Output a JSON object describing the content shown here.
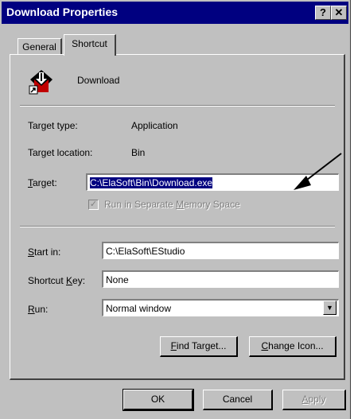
{
  "window": {
    "title": "Download Properties",
    "help_glyph": "?",
    "close_glyph": "✕"
  },
  "tabs": [
    {
      "label": "General",
      "active": false
    },
    {
      "label": "Shortcut",
      "active": true
    }
  ],
  "shortcut": {
    "name": "Download",
    "icon": "download-app-icon",
    "target_type_label": "Target type:",
    "target_type_value": "Application",
    "target_location_label": "Target location:",
    "target_location_value": "Bin",
    "target_label_hotkey": "T",
    "target_label_rest": "arget:",
    "target_value": "C:\\ElaSoft\\Bin\\Download.exe",
    "separate_memory_pre": "Run in Separate ",
    "separate_memory_hotkey": "M",
    "separate_memory_post": "emory Space",
    "separate_memory_checked": true,
    "start_in_hotkey": "S",
    "start_in_rest": "tart in:",
    "start_in_value": "C:\\ElaSoft\\EStudio",
    "shortcut_key_pre": "Shortcut ",
    "shortcut_key_hotkey": "K",
    "shortcut_key_post": "ey:",
    "shortcut_key_value": "None",
    "run_hotkey": "R",
    "run_rest": "un:",
    "run_value": "Normal window",
    "find_target_hotkey": "F",
    "find_target_rest": "ind Target...",
    "change_icon_hotkey": "C",
    "change_icon_rest": "hange Icon..."
  },
  "footer": {
    "ok_label": "OK",
    "cancel_label": "Cancel",
    "apply_hotkey": "A",
    "apply_rest": "pply"
  },
  "colors": {
    "titlebar": "#000080",
    "face": "#c0c0c0",
    "selection": "#000080"
  }
}
